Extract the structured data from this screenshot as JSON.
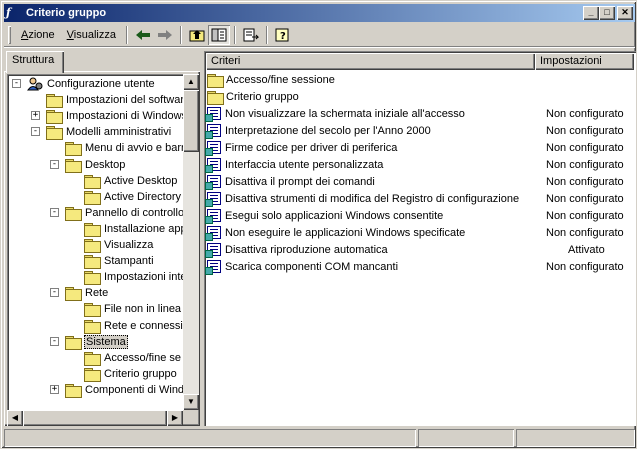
{
  "window": {
    "title": "Criterio gruppo"
  },
  "menu": {
    "action": "Azione",
    "action_underline": "A",
    "view": "Visualizza",
    "view_underline": "V"
  },
  "left_tab": "Struttura",
  "tree": [
    {
      "label": "Configurazione utente"
    },
    {
      "label": "Impostazioni del software"
    },
    {
      "label": "Impostazioni di Windows"
    },
    {
      "label": "Modelli amministrativi"
    },
    {
      "label": "Menu di avvio e barr"
    },
    {
      "label": "Desktop"
    },
    {
      "label": "Active Desktop"
    },
    {
      "label": "Active Directory"
    },
    {
      "label": "Pannello di controllo"
    },
    {
      "label": "Installazione app"
    },
    {
      "label": "Visualizza"
    },
    {
      "label": "Stampanti"
    },
    {
      "label": "Impostazioni inte"
    },
    {
      "label": "Rete"
    },
    {
      "label": "File non in linea"
    },
    {
      "label": "Rete e connessi"
    },
    {
      "label": "Sistema"
    },
    {
      "label": "Accesso/fine se"
    },
    {
      "label": "Criterio gruppo"
    },
    {
      "label": "Componenti di Windo"
    }
  ],
  "columns": {
    "name": "Criteri",
    "setting": "Impostazioni"
  },
  "list": [
    {
      "name": "Accesso/fine sessione",
      "status": ""
    },
    {
      "name": "Criterio gruppo",
      "status": ""
    },
    {
      "name": "Non visualizzare la schermata iniziale all'accesso",
      "status": "Non configurato"
    },
    {
      "name": "Interpretazione del secolo per l'Anno 2000",
      "status": "Non configurato"
    },
    {
      "name": "Firme codice per driver di periferica",
      "status": "Non configurato"
    },
    {
      "name": "Interfaccia utente personalizzata",
      "status": "Non configurato"
    },
    {
      "name": "Disattiva il prompt dei comandi",
      "status": "Non configurato"
    },
    {
      "name": "Disattiva strumenti di modifica del Registro di configurazione",
      "status": "Non configurato"
    },
    {
      "name": "Esegui solo applicazioni Windows consentite",
      "status": "Non configurato"
    },
    {
      "name": "Non eseguire le applicazioni Windows specificate",
      "status": "Non configurato"
    },
    {
      "name": "Disattiva riproduzione automatica",
      "status": "Attivato"
    },
    {
      "name": "Scarica componenti COM mancanti",
      "status": "Non configurato"
    }
  ],
  "icons": {
    "back": "arrow-left-icon",
    "forward": "arrow-right-icon",
    "up": "folder-up-icon",
    "show_hide_tree": "show-hide-tree-icon",
    "export": "export-list-icon",
    "help": "help-icon"
  },
  "colors": {
    "title_start": "#0a246a",
    "title_end": "#a6caf0",
    "chrome": "#d4d0c8"
  }
}
